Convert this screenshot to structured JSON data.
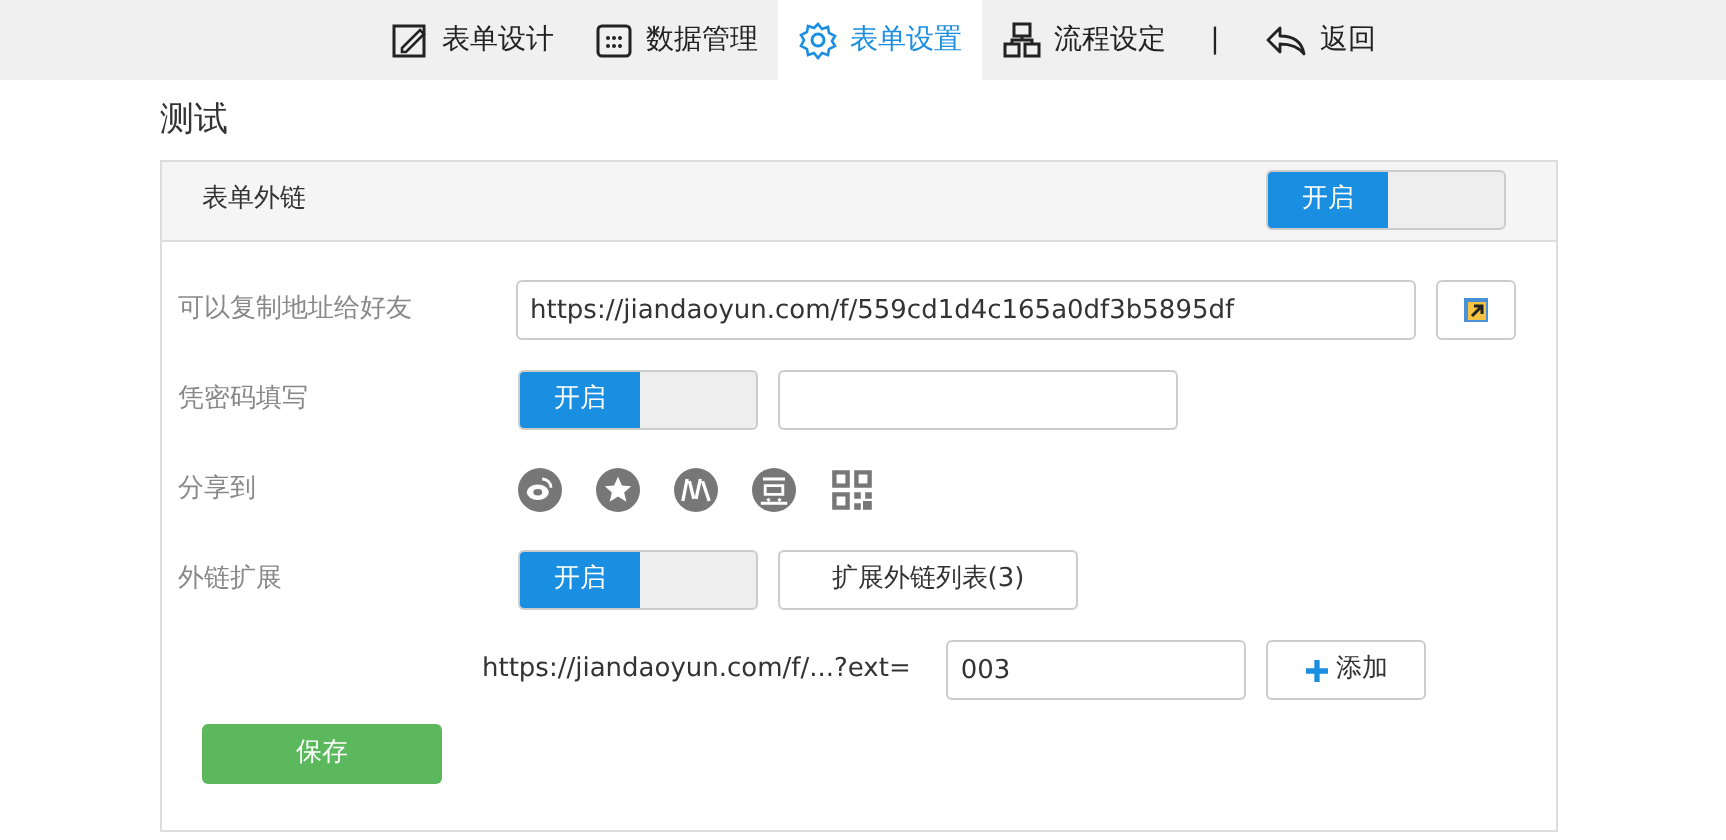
{
  "nav": {
    "tabs": [
      {
        "label": "表单设计",
        "selected": false
      },
      {
        "label": "数据管理",
        "selected": false
      },
      {
        "label": "表单设置",
        "selected": true
      },
      {
        "label": "流程设定",
        "selected": false
      }
    ],
    "separator": "|",
    "back": "返回"
  },
  "page_title": "测试",
  "panel": {
    "title": "表单外链",
    "toggle": {
      "label": "开启",
      "on": true
    },
    "rows": [
      {
        "kind": "link",
        "label": "可以复制地址给好友",
        "value": "https://jiandaoyun.com/f/559cd1d4c165a0df3b5895df"
      },
      {
        "kind": "password",
        "label": "凭密码填写",
        "toggle": {
          "label": "开启",
          "on": true
        }
      },
      {
        "kind": "share",
        "label": "分享到"
      },
      {
        "kind": "extend",
        "label": "外链扩展",
        "toggle": {
          "label": "开启",
          "on": true
        },
        "button": "扩展外链列表(3)"
      },
      {
        "kind": "ext",
        "prefix": "https://jiandaoyun.com/f/...?ext=",
        "value": "003",
        "button": "添加"
      }
    ],
    "save": "保存"
  }
}
